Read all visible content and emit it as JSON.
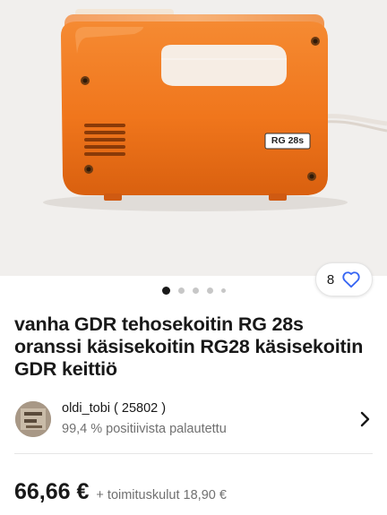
{
  "listing": {
    "title": "vanha GDR tehosekoitin RG 28s oranssi käsisekoitin RG28 käsisekoitin GDR keittiö",
    "watch_count": "8",
    "gallery": {
      "photo_count": 5,
      "active_index": 0
    },
    "product_label": "RG 28s"
  },
  "seller": {
    "name": "oldi_tobi ( 25802 )",
    "feedback": "99,4 % positiivista palautettu"
  },
  "price": {
    "amount": "66,66 €",
    "shipping": "+ toimituskulut 18,90 €"
  },
  "icons": {
    "watch": "heart-icon",
    "seller_link": "chevron-right-icon"
  },
  "colors": {
    "accent": "#3665f3",
    "text": "#191919",
    "muted": "#707070",
    "product_orange": "#f07a22"
  }
}
